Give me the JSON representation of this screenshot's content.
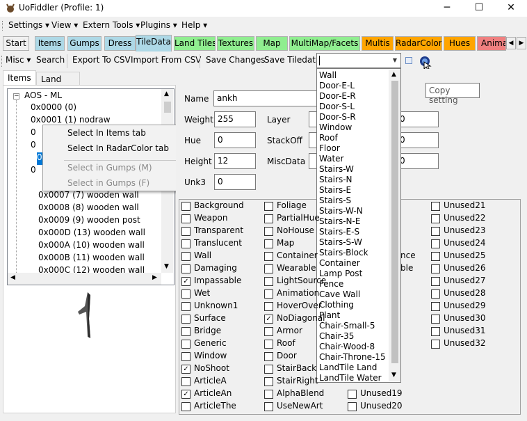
{
  "window": {
    "title": "UoFiddler (Profile: 1)",
    "min": "─",
    "max": "☐",
    "close": "✕"
  },
  "menu": [
    "Settings",
    "View",
    "Extern Tools",
    "Plugins",
    "Help"
  ],
  "tabs": [
    {
      "label": "Start",
      "color": "#f0f0f0"
    },
    {
      "label": "Items",
      "color": "#add8e6"
    },
    {
      "label": "Gumps",
      "color": "#add8e6"
    },
    {
      "label": "Dress",
      "color": "#add8e6"
    },
    {
      "label": "TileData",
      "color": "#add8e6"
    },
    {
      "label": "Land Tiles",
      "color": "#90ee90"
    },
    {
      "label": "Textures",
      "color": "#90ee90"
    },
    {
      "label": "Map",
      "color": "#90ee90"
    },
    {
      "label": "MultiMap/Facets",
      "color": "#90ee90"
    },
    {
      "label": "Multis",
      "color": "#ffa500"
    },
    {
      "label": "RadarColor",
      "color": "#ffa500"
    },
    {
      "label": "Hues",
      "color": "#ffa500"
    },
    {
      "label": "Anima",
      "color": "#f08080"
    }
  ],
  "toolbar": {
    "misc": "Misc",
    "search": "Search",
    "export": "Export To CSV",
    "import": "Import From CSV",
    "save_changes": "Save Changes",
    "save_tiledata": "Save Tiledata"
  },
  "inner_tabs": [
    "Items",
    "Land Tiles"
  ],
  "tree": {
    "root": "AOS - ML",
    "items": [
      "0x0000 (0)",
      "0x0001 (1) nodraw",
      "0",
      "0",
      "0",
      "0",
      "0x0007 (7) wooden wall",
      "0x0008 (8) wooden wall",
      "0x0009 (9) wooden post",
      "0x000A (10) wooden wall",
      "0x000B (11) wooden wall",
      "0x000C (12) wooden wall",
      "0x000D (13) wooden wall"
    ]
  },
  "context_menu": {
    "items": [
      "Select In Items tab",
      "Select In RadarColor tab",
      "Select in Gumps (M)",
      "Select in Gumps (F)"
    ]
  },
  "fields": {
    "name_label": "Name",
    "name_value": "ankh",
    "weight_label": "Weight",
    "weight_value": "255",
    "layer_label": "Layer",
    "hue_label": "Hue",
    "hue_value": "0",
    "stackoff_label": "StackOff",
    "height_label": "Height",
    "height_value": "12",
    "miscdata_label": "MiscData",
    "unk3_label": "Unk3",
    "unk3_value": "0",
    "right_values": [
      "0",
      "0",
      "0"
    ]
  },
  "flags_col1": [
    {
      "label": "Background",
      "checked": false
    },
    {
      "label": "Weapon",
      "checked": false
    },
    {
      "label": "Transparent",
      "checked": false
    },
    {
      "label": "Translucent",
      "checked": false
    },
    {
      "label": "Wall",
      "checked": false
    },
    {
      "label": "Damaging",
      "checked": false
    },
    {
      "label": "Impassable",
      "checked": true
    },
    {
      "label": "Wet",
      "checked": false
    },
    {
      "label": "Unknown1",
      "checked": false
    },
    {
      "label": "Surface",
      "checked": false
    },
    {
      "label": "Bridge",
      "checked": false
    },
    {
      "label": "Generic",
      "checked": false
    },
    {
      "label": "Window",
      "checked": false
    },
    {
      "label": "NoShoot",
      "checked": true
    },
    {
      "label": "ArticleA",
      "checked": false
    },
    {
      "label": "ArticleAn",
      "checked": true
    },
    {
      "label": "ArticleThe",
      "checked": false
    }
  ],
  "flags_col2": [
    {
      "label": "Foliage",
      "checked": false
    },
    {
      "label": "PartialHue",
      "checked": false
    },
    {
      "label": "NoHouse",
      "checked": false
    },
    {
      "label": "Map",
      "checked": false
    },
    {
      "label": "Container",
      "checked": false
    },
    {
      "label": "Wearable",
      "checked": false
    },
    {
      "label": "LightSource",
      "checked": false
    },
    {
      "label": "Animation",
      "checked": false
    },
    {
      "label": "HoverOver",
      "checked": false
    },
    {
      "label": "NoDiagonal",
      "checked": true
    },
    {
      "label": "Armor",
      "checked": false
    },
    {
      "label": "Roof",
      "checked": false
    },
    {
      "label": "Door",
      "checked": false
    },
    {
      "label": "StairBack",
      "checked": false
    },
    {
      "label": "StairRight",
      "checked": false
    },
    {
      "label": "AlphaBlend",
      "checked": false
    },
    {
      "label": "UseNewArt",
      "checked": false
    }
  ],
  "flags_col3_visible": [
    "nce",
    "ble",
    "Unused19",
    "Unused20"
  ],
  "flags_col4": [
    "Unused21",
    "Unused22",
    "Unused23",
    "Unused24",
    "Unused25",
    "Unused26",
    "Unused27",
    "Unused28",
    "Unused29",
    "Unused30",
    "Unused31",
    "Unused32"
  ],
  "dropdown": [
    "Wall",
    "Door-E-L",
    "Door-E-R",
    "Door-S-L",
    "Door-S-R",
    "Window",
    "Roof",
    "Floor",
    "Water",
    "Stairs-W",
    "Stairs-N",
    "Stairs-E",
    "Stairs-S",
    "Stairs-W-N",
    "Stairs-N-E",
    "Stairs-E-S",
    "Stairs-S-W",
    "Stairs-Block",
    "Container",
    "Lamp Post",
    "Fence",
    "Cave Wall",
    "Clothing",
    "Plant",
    "Chair-Small-5",
    "Chair-35",
    "Chair-Wood-8",
    "Chair-Throne-15",
    "LandTile Land",
    "LandTile Water"
  ],
  "tooltip": "Copy setting"
}
